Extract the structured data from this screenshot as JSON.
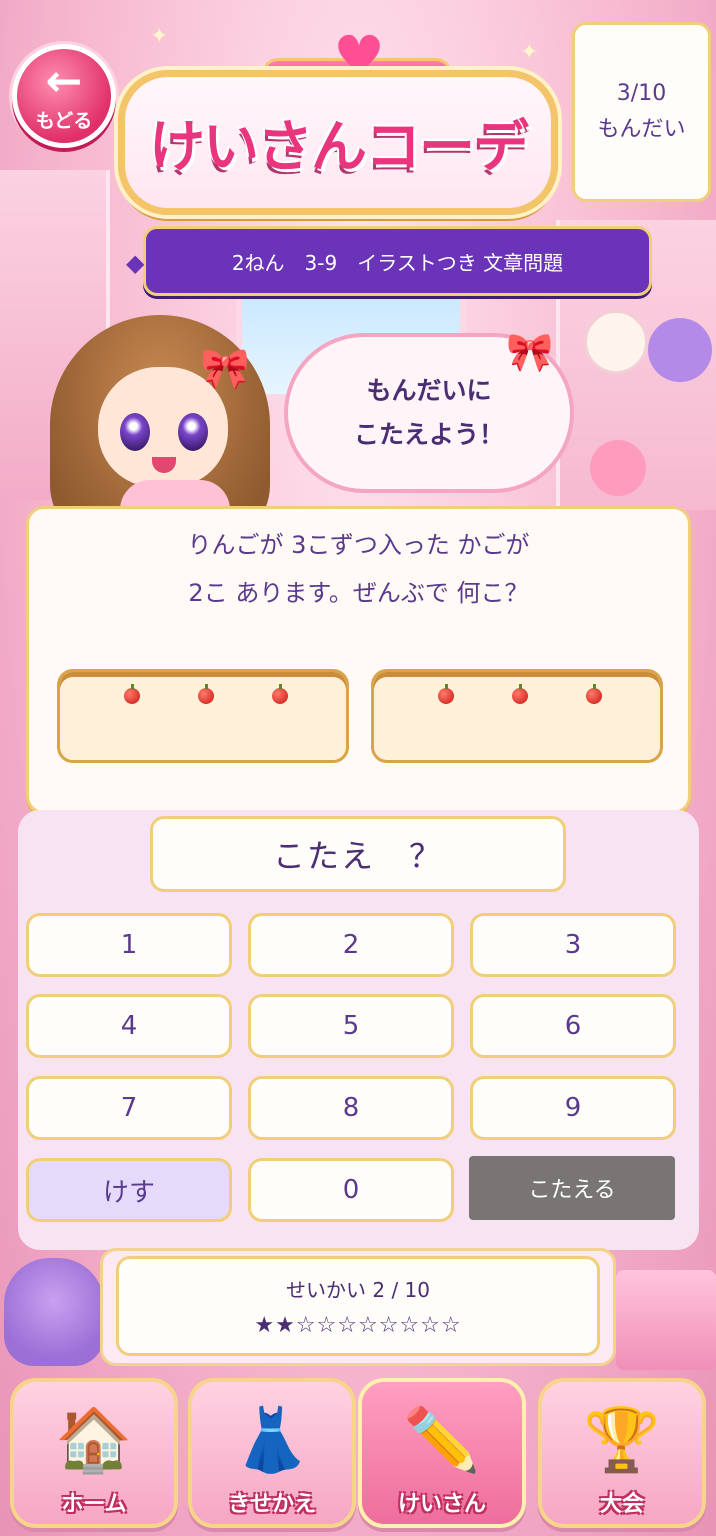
{
  "header": {
    "back_label": "もどる",
    "app_title": "けいさんコーデ",
    "progress_fraction": "3/10",
    "progress_label": "もんだい"
  },
  "lesson": {
    "title": "2ねん　3-9　イラストつき 文章問題"
  },
  "speech": {
    "line1": "もんだいに",
    "line2": "こたえよう！"
  },
  "question": {
    "line1": "りんごが 3こずつ入った かごが",
    "line2": "2こ あります。ぜんぶで 何こ？",
    "baskets": [
      {
        "apples": 3
      },
      {
        "apples": 3
      }
    ]
  },
  "answer": {
    "display": "こたえ　？"
  },
  "keypad": {
    "keys": [
      "1",
      "2",
      "3",
      "4",
      "5",
      "6",
      "7",
      "8",
      "9"
    ],
    "clear_label": "けす",
    "zero_label": "0",
    "submit_label": "こたえる"
  },
  "score": {
    "label": "せいかい 2 / 10",
    "stars": "★★☆☆☆☆☆☆☆☆",
    "correct": 2,
    "total": 10
  },
  "nav": {
    "items": [
      {
        "label": "ホーム",
        "icon": "house-icon"
      },
      {
        "label": "きせかえ",
        "icon": "dress-icon"
      },
      {
        "label": "けいさん",
        "icon": "pencil-icon",
        "active": true
      },
      {
        "label": "大会",
        "icon": "trophy-icon"
      }
    ]
  },
  "colors": {
    "accent_purple": "#6b34b8",
    "accent_pink": "#e9357d",
    "gold_border": "#f1cf7a",
    "submit_gray": "#7a7575"
  }
}
